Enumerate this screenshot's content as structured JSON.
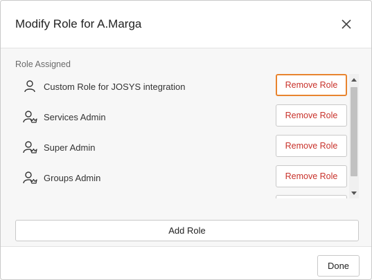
{
  "dialog": {
    "title": "Modify Role for A.Marga",
    "close_icon": "close-icon"
  },
  "roles_section": {
    "label": "Role Assigned",
    "roles": [
      {
        "name": "Custom Role for JOSYS integration",
        "icon": "user-icon",
        "action_label": "Remove Role"
      },
      {
        "name": "Services Admin",
        "icon": "admin-user-icon",
        "action_label": "Remove Role"
      },
      {
        "name": "Super Admin",
        "icon": "admin-user-icon",
        "action_label": "Remove Role"
      },
      {
        "name": "Groups Admin",
        "icon": "admin-user-icon",
        "action_label": "Remove Role"
      }
    ]
  },
  "actions": {
    "add_role_label": "Add Role",
    "done_label": "Done"
  },
  "colors": {
    "remove_text": "#c8312a",
    "focus_outline": "#e8842e"
  }
}
